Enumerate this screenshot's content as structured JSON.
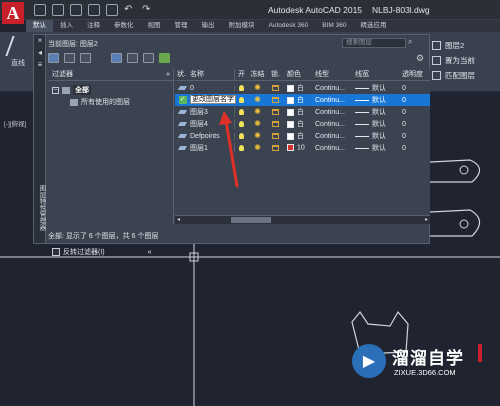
{
  "titlebar": {
    "app_title": "Autodesk AutoCAD 2015",
    "file_title": "NLBJ-803l.dwg"
  },
  "ribbon_tabs": [
    "默认",
    "插入",
    "注释",
    "参数化",
    "视图",
    "管理",
    "输出",
    "附加模块",
    "Autodesk 360",
    "BIM 360",
    "精选应用"
  ],
  "ribbon": {
    "line_tool": "直线",
    "layer_label": "图层2",
    "set_current": "置为当前",
    "match_layer": "匹配图层",
    "drawing_tab": "N",
    "viewport_label": "[-][俯视]"
  },
  "palette": {
    "current_layer": "当前图层: 图层2",
    "search_placeholder": "搜索图层",
    "side_label": "图层特性管理器",
    "filter_header": "过滤器",
    "tree_root": "全部",
    "tree_child": "所有使用的图层",
    "invert_filter": "反转过滤器(I)",
    "status": "全部: 显示了 6 个图层，共 6 个图层"
  },
  "grid": {
    "headers": {
      "status": "状.",
      "name": "名称",
      "on": "开",
      "freeze": "冻结",
      "lock": "锁.",
      "color": "颜色",
      "linetype": "线型",
      "lineweight": "线宽",
      "transparency": "透明度"
    },
    "rows": [
      {
        "name": "0",
        "color_name": "白",
        "color_hex": "#ffffff",
        "linetype": "Continu...",
        "lineweight": "默认",
        "transparency": "0",
        "selected": false
      },
      {
        "name": "更改图层名字",
        "color_name": "白",
        "color_hex": "#ffffff",
        "linetype": "Continu...",
        "lineweight": "默认",
        "transparency": "0",
        "selected": true
      },
      {
        "name": "图层3",
        "color_name": "白",
        "color_hex": "#ffffff",
        "linetype": "Continu...",
        "lineweight": "默认",
        "transparency": "0",
        "selected": false
      },
      {
        "name": "图层4",
        "color_name": "白",
        "color_hex": "#ffffff",
        "linetype": "Continu...",
        "lineweight": "默认",
        "transparency": "0",
        "selected": false
      },
      {
        "name": "Defpoints",
        "color_name": "白",
        "color_hex": "#ffffff",
        "linetype": "Continu...",
        "lineweight": "默认",
        "transparency": "0",
        "selected": false
      },
      {
        "name": "图层1",
        "color_name": "10",
        "color_hex": "#d32f2f",
        "linetype": "Continu...",
        "lineweight": "默认",
        "transparency": "0",
        "selected": false
      }
    ]
  },
  "watermark": {
    "brand": "溜溜自学",
    "url": "ZIXUE.3D66.COM"
  },
  "colors": {
    "selection": "#1877d6",
    "canvas": "#1f2430",
    "autocad_red": "#c8202a",
    "annotation_arrow": "#e0302a"
  }
}
